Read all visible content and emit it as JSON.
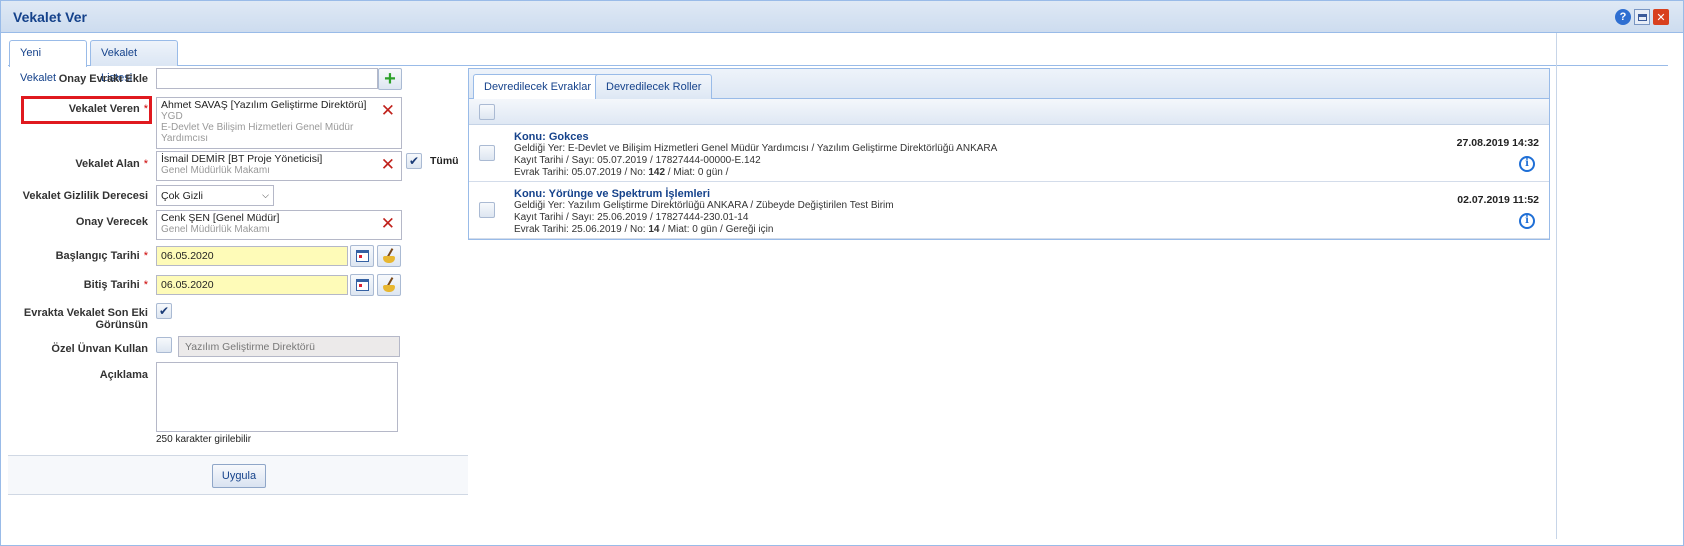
{
  "window": {
    "title": "Vekalet Ver"
  },
  "main_tabs": [
    {
      "label": "Yeni Vekalet",
      "active": true
    },
    {
      "label": "Vekalet Listesi",
      "active": false
    }
  ],
  "form": {
    "onay_evraki_ekle": {
      "label": "Onay Evrakı Ekle",
      "value": ""
    },
    "vekalet_veren": {
      "label": "Vekalet Veren",
      "name": "Ahmet SAVAŞ [Yazılım Geliştirme Direktörü]",
      "sub1": "YGD",
      "sub2": "E-Devlet Ve Bilişim Hizmetleri Genel Müdür",
      "sub3": "Yardımcısı"
    },
    "vekalet_alan": {
      "label": "Vekalet Alan",
      "name": "İsmail DEMİR [BT Proje Yöneticisi]",
      "sub1": "Genel Müdürlük Makamı",
      "all_label": "Tümü",
      "all_checked": true
    },
    "gizlilik": {
      "label": "Vekalet Gizlilik Derecesi",
      "value": "Çok Gizli"
    },
    "onay_verecek": {
      "label": "Onay Verecek",
      "name": "Cenk ŞEN [Genel Müdür]",
      "sub1": "Genel Müdürlük Makamı"
    },
    "baslangic": {
      "label": "Başlangıç Tarihi",
      "value": "06.05.2020"
    },
    "bitis": {
      "label": "Bitiş Tarihi",
      "value": "06.05.2020"
    },
    "son_ek": {
      "label_line1": "Evrakta Vekalet Son Eki",
      "label_line2": "Görünsün",
      "checked": true
    },
    "ozel_unvan": {
      "label": "Özel Ünvan Kullan",
      "checked": false,
      "placeholder": "Yazılım Geliştirme Direktörü"
    },
    "aciklama": {
      "label": "Açıklama",
      "value": "",
      "hint": "250 karakter girilebilir"
    },
    "apply_label": "Uygula",
    "required_mark": "*"
  },
  "right_panel": {
    "tabs": [
      {
        "label": "Devredilecek Evraklar",
        "active": true
      },
      {
        "label": "Devredilecek Roller",
        "active": false
      }
    ],
    "documents": [
      {
        "subject": "Konu: Gokces",
        "line1": "Geldiği Yer: E-Devlet ve Bilişim Hizmetleri Genel Müdür Yardımcısı / Yazılım Geliştirme Direktörlüğü ANKARA",
        "line2": "Kayıt Tarihi / Sayı: 05.07.2019 / 17827444-00000-E.142",
        "line3_pre": "Evrak Tarihi: 05.07.2019 / No: ",
        "line3_no": "142",
        "line3_post": " / Miat: 0 gün /",
        "date": "27.08.2019 14:32"
      },
      {
        "subject": "Konu: Yörünge ve Spektrum İşlemleri",
        "line1": "Geldiği Yer: Yazılım Geliştirme Direktörlüğü ANKARA / Zübeyde Değiştirilen Test Birim",
        "line2": "Kayıt Tarihi / Sayı: 25.06.2019 / 17827444-230.01-14",
        "line3_pre": "Evrak Tarihi: 25.06.2019 / No: ",
        "line3_no": "14",
        "line3_post": " / Miat: 0 gün / Gereği için",
        "date": "02.07.2019 11:52"
      }
    ]
  },
  "icons": {
    "help": "?",
    "close": "✕",
    "x_mark": "✕",
    "plus": "+",
    "check": "✔",
    "chevron": "⌵",
    "info": "i"
  }
}
